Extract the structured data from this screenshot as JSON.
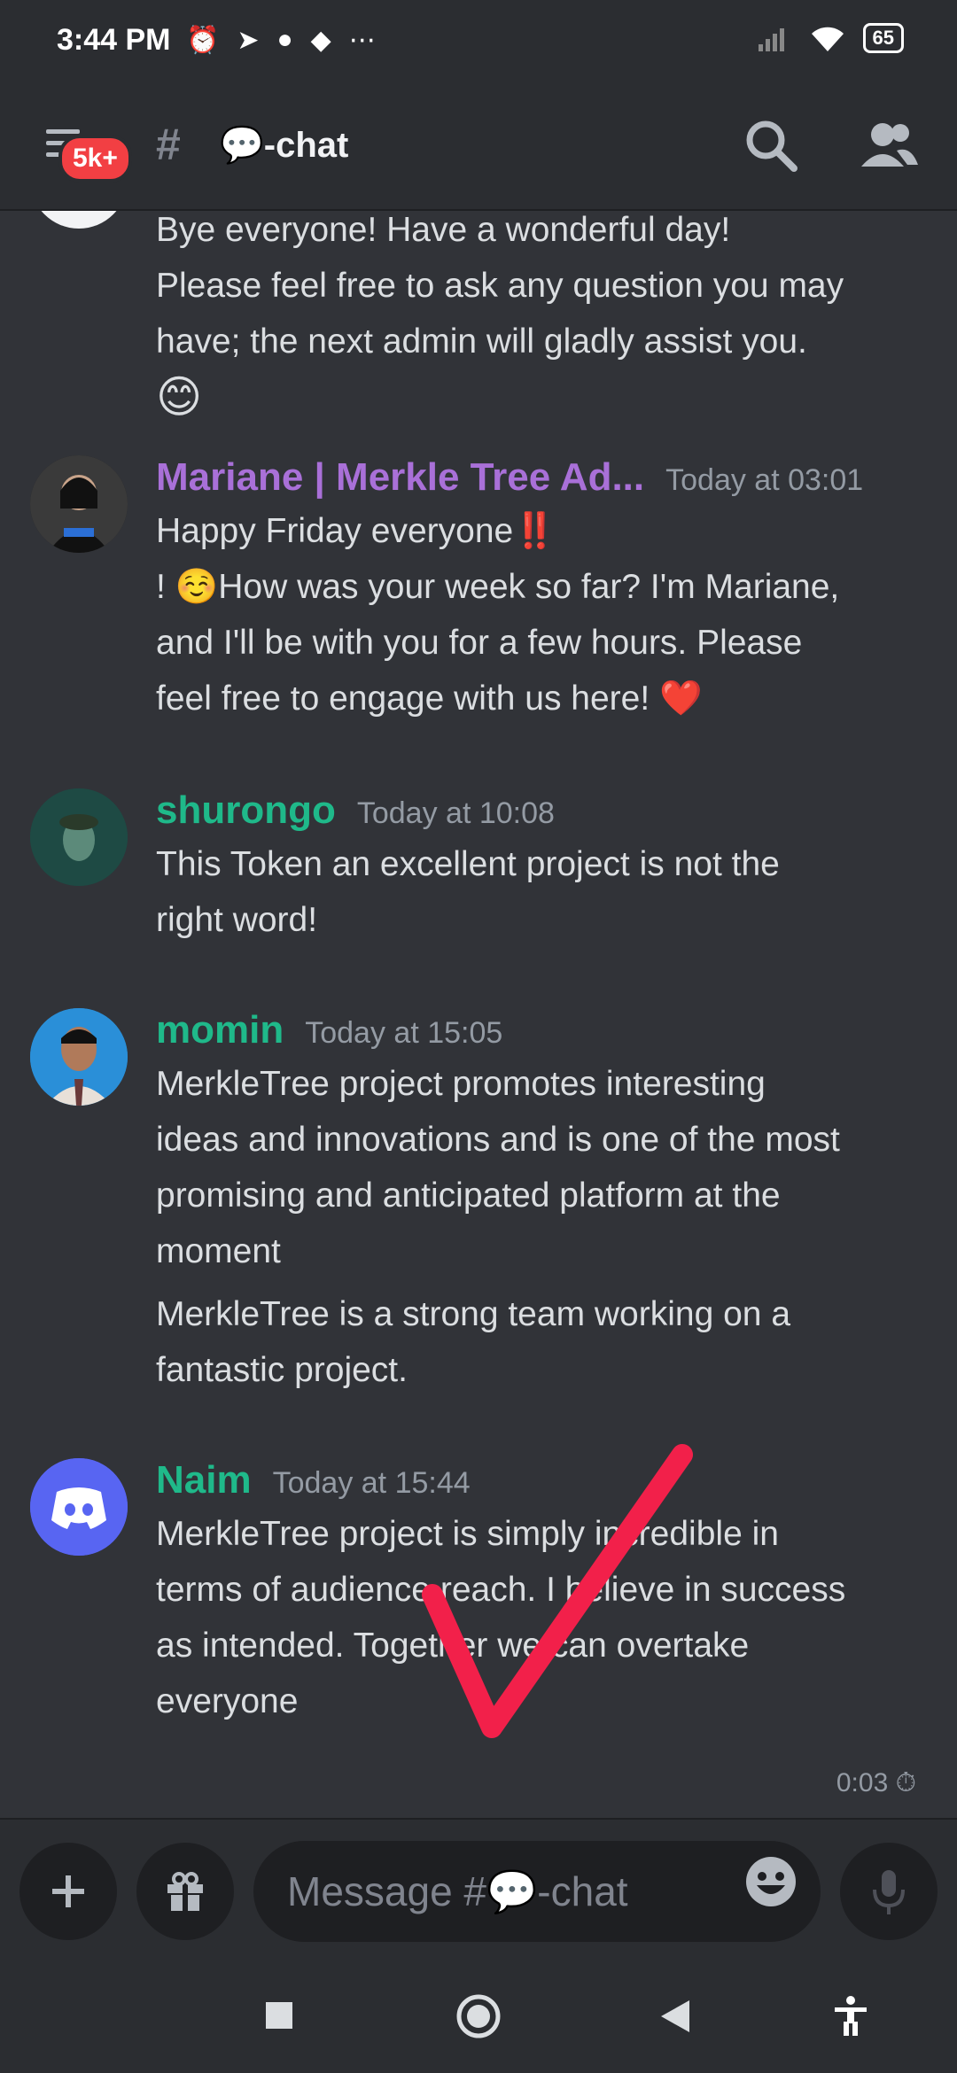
{
  "status_bar": {
    "time": "3:44 PM",
    "battery": "65"
  },
  "header": {
    "channel_name": "💬-chat",
    "notification_badge": "5k+"
  },
  "messages": [
    {
      "lines": [
        "Bye everyone! Have a wonderful day!",
        "Please feel free to ask any question you may",
        "have; the next admin will gladly assist you."
      ],
      "emoji": "😊"
    },
    {
      "username": "Mariane | Merkle Tree Ad...",
      "username_color": "#a970d8",
      "timestamp": "Today at 03:01",
      "lines": [
        "Happy  Friday everyone‼️",
        "! ☺️How was your week so far? I'm Mariane,",
        "and I'll be with you for a few hours. Please",
        "feel free to engage with us here! ❤️"
      ]
    },
    {
      "username": "shurongo",
      "username_color": "#1fb98a",
      "timestamp": "Today at 10:08",
      "lines": [
        "This Token an excellent project is not the",
        "right word!"
      ]
    },
    {
      "username": "momin",
      "username_color": "#1fb98a",
      "timestamp": "Today at 15:05",
      "lines": [
        "MerkleTree project promotes interesting",
        "ideas and innovations and is one of the most",
        "promising and anticipated platform at the",
        "moment"
      ],
      "lines2": [
        "MerkleTree is a strong team working on a",
        "fantastic project."
      ]
    },
    {
      "username": "Naim",
      "username_color": "#1fb98a",
      "timestamp": "Today at 15:44",
      "lines": [
        "MerkleTree  project is simply incredible in",
        "terms of audience reach. I believe in success",
        "as intended. Together we can overtake",
        "everyone"
      ]
    }
  ],
  "slowmode_timer": "0:03",
  "composer": {
    "placeholder": "Message #💬-chat"
  },
  "colors": {
    "background": "#313338",
    "bar": "#2b2d31",
    "blurple": "#5865f2",
    "check": "#f2204a"
  },
  "icons": [
    "alarm-icon",
    "telegram-icon",
    "reddit-icon",
    "discord-icon",
    "signal-icon",
    "wifi-icon",
    "search-icon",
    "members-icon",
    "plus-icon",
    "gift-icon",
    "emoji-icon",
    "mic-icon",
    "stopwatch-icon"
  ]
}
